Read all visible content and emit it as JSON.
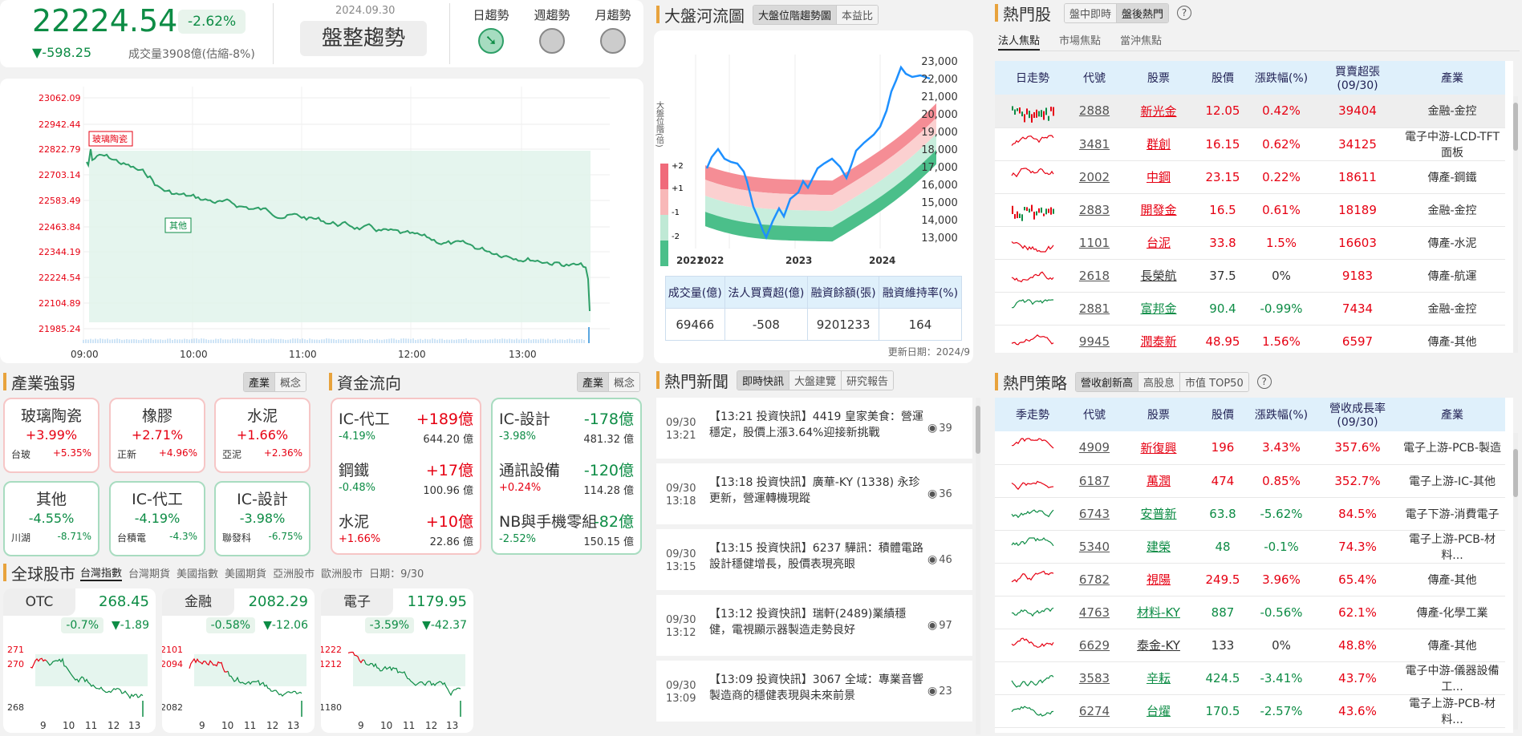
{
  "index": {
    "value": "22224.54",
    "pct": "-2.62%",
    "change": "▼-598.25",
    "volume": "成交量3908億(估縮-8%)",
    "date": "2024.09.30",
    "trend": "盤整趨勢",
    "trends": [
      "日趨勢",
      "週趨勢",
      "月趨勢"
    ]
  },
  "intraday": {
    "yticks": [
      "23062.09",
      "22942.44",
      "22822.79",
      "22703.14",
      "22583.49",
      "22463.84",
      "22344.19",
      "22224.54",
      "22104.89",
      "21985.24"
    ],
    "xticks": [
      "09:00",
      "10:00",
      "11:00",
      "12:00",
      "13:00"
    ],
    "tag1": "玻璃陶瓷",
    "tag2": "其他"
  },
  "river": {
    "title": "大盤河流圖",
    "tabs": [
      "大盤位階趨勢圖",
      "本益比"
    ],
    "ylabel": "大盤位階(倍)",
    "bands": [
      "+2",
      "+1",
      "-1",
      "-2"
    ],
    "yticks": [
      "23,000",
      "22,000",
      "21,000",
      "20,000",
      "19,000",
      "18,000",
      "17,000",
      "16,000",
      "15,000",
      "14,000",
      "13,000"
    ],
    "xticks": [
      "2021",
      "2022",
      "2023",
      "2024"
    ],
    "table_head": [
      "成交量(億)",
      "法人買賣超(億)",
      "融資餘額(張)",
      "融資維持率(%)"
    ],
    "table_vals": [
      "69466",
      "-508",
      "9201233",
      "164"
    ],
    "update": "更新日期：2024/9"
  },
  "hot": {
    "title": "熱門股",
    "tabs": [
      "盤中即時",
      "盤後熱門"
    ],
    "subtabs": [
      "法人焦點",
      "市場焦點",
      "當沖焦點"
    ],
    "head": [
      "日走勢",
      "代號",
      "股票",
      "股價",
      "漲跌幅(%)",
      "買賣超張(09/30)",
      "產業"
    ],
    "rows": [
      {
        "code": "2888",
        "name": "新光金",
        "price": "12.05",
        "pct": "0.42%",
        "amt": "39404",
        "ind": "金融-金控",
        "c": "up"
      },
      {
        "code": "3481",
        "name": "群創",
        "price": "16.15",
        "pct": "0.62%",
        "amt": "34125",
        "ind": "電子中游-LCD-TFT面板",
        "c": "up"
      },
      {
        "code": "2002",
        "name": "中鋼",
        "price": "23.15",
        "pct": "0.22%",
        "amt": "18611",
        "ind": "傳產-鋼鐵",
        "c": "up"
      },
      {
        "code": "2883",
        "name": "開發金",
        "price": "16.5",
        "pct": "0.61%",
        "amt": "18189",
        "ind": "金融-金控",
        "c": "up"
      },
      {
        "code": "1101",
        "name": "台泥",
        "price": "33.8",
        "pct": "1.5%",
        "amt": "16603",
        "ind": "傳產-水泥",
        "c": "up"
      },
      {
        "code": "2618",
        "name": "長榮航",
        "price": "37.5",
        "pct": "0%",
        "amt": "9183",
        "ind": "傳產-航運",
        "c": "nt"
      },
      {
        "code": "2881",
        "name": "富邦金",
        "price": "90.4",
        "pct": "-0.99%",
        "amt": "7434",
        "ind": "金融-金控",
        "c": "dn"
      },
      {
        "code": "9945",
        "name": "潤泰新",
        "price": "48.95",
        "pct": "1.56%",
        "amt": "6597",
        "ind": "傳產-其他",
        "c": "up"
      }
    ]
  },
  "strat": {
    "title": "熱門策略",
    "tabs": [
      "營收創新高",
      "高股息",
      "市值 TOP50"
    ],
    "head": [
      "季走勢",
      "代號",
      "股票",
      "股價",
      "漲跌幅(%)",
      "營收成長率(09/30)",
      "產業"
    ],
    "rows": [
      {
        "code": "4909",
        "name": "新復興",
        "price": "196",
        "pct": "3.43%",
        "g": "357.6%",
        "ind": "電子上游-PCB-製造",
        "c": "up"
      },
      {
        "code": "6187",
        "name": "萬潤",
        "price": "474",
        "pct": "0.85%",
        "g": "352.7%",
        "ind": "電子上游-IC-其他",
        "c": "up"
      },
      {
        "code": "6743",
        "name": "安普新",
        "price": "63.8",
        "pct": "-5.62%",
        "g": "84.5%",
        "ind": "電子下游-消費電子",
        "c": "dn"
      },
      {
        "code": "5340",
        "name": "建榮",
        "price": "48",
        "pct": "-0.1%",
        "g": "74.3%",
        "ind": "電子上游-PCB-材料...",
        "c": "dn"
      },
      {
        "code": "6782",
        "name": "視陽",
        "price": "249.5",
        "pct": "3.96%",
        "g": "65.4%",
        "ind": "傳產-其他",
        "c": "up"
      },
      {
        "code": "4763",
        "name": "材料-KY",
        "price": "887",
        "pct": "-0.56%",
        "g": "62.1%",
        "ind": "傳產-化學工業",
        "c": "dn"
      },
      {
        "code": "6629",
        "name": "泰金-KY",
        "price": "133",
        "pct": "0%",
        "g": "48.8%",
        "ind": "傳產-其他",
        "c": "nt"
      },
      {
        "code": "3583",
        "name": "辛耘",
        "price": "424.5",
        "pct": "-3.41%",
        "g": "43.7%",
        "ind": "電子中游-儀器設備工...",
        "c": "dn"
      },
      {
        "code": "6274",
        "name": "台燿",
        "price": "170.5",
        "pct": "-2.57%",
        "g": "43.6%",
        "ind": "電子上游-PCB-材料...",
        "c": "dn"
      }
    ]
  },
  "industry": {
    "title": "產業強弱",
    "tabs": [
      "產業",
      "概念"
    ],
    "items": [
      {
        "n": "玻璃陶瓷",
        "p": "+3.99%",
        "s": "台玻",
        "sp": "+5.35%",
        "c": "up"
      },
      {
        "n": "橡膠",
        "p": "+2.71%",
        "s": "正新",
        "sp": "+4.96%",
        "c": "up"
      },
      {
        "n": "水泥",
        "p": "+1.66%",
        "s": "亞泥",
        "sp": "+2.36%",
        "c": "up"
      },
      {
        "n": "其他",
        "p": "-4.55%",
        "s": "川湖",
        "sp": "-8.71%",
        "c": "dn"
      },
      {
        "n": "IC-代工",
        "p": "-4.19%",
        "s": "台積電",
        "sp": "-4.3%",
        "c": "dn"
      },
      {
        "n": "IC-設計",
        "p": "-3.98%",
        "s": "聯發科",
        "sp": "-6.75%",
        "c": "dn"
      }
    ]
  },
  "capital": {
    "title": "資金流向",
    "tabs": [
      "產業",
      "概念"
    ],
    "in": [
      {
        "n": "IC-代工",
        "v": "+189億",
        "p": "-4.19%",
        "t": "644.20 億",
        "pc": "dn"
      },
      {
        "n": "鋼鐵",
        "v": "+17億",
        "p": "-0.48%",
        "t": "100.96 億",
        "pc": "dn"
      },
      {
        "n": "水泥",
        "v": "+10億",
        "p": "+1.66%",
        "t": "22.86 億",
        "pc": "up"
      }
    ],
    "out": [
      {
        "n": "IC-設計",
        "v": "-178億",
        "p": "-3.98%",
        "t": "481.32 億",
        "pc": "dn"
      },
      {
        "n": "通訊設備",
        "v": "-120億",
        "p": "+0.24%",
        "t": "114.28 億",
        "pc": "up"
      },
      {
        "n": "NB與手機零組",
        "v": "-82億",
        "p": "-2.52%",
        "t": "150.15 億",
        "pc": "dn"
      }
    ]
  },
  "news": {
    "title": "熱門新聞",
    "tabs": [
      "即時快訊",
      "大盤建覽",
      "研究報告"
    ],
    "items": [
      {
        "d": "09/30",
        "t": "13:21",
        "x": "【13:21 投資快訊】4419 皇家美食：營運穩定，股價上漲3.64%迎接新挑戰",
        "v": "39"
      },
      {
        "d": "09/30",
        "t": "13:18",
        "x": "【13:18 投資快訊】廣華-KY (1338) 永珍更新，營運轉機現蹤",
        "v": "36"
      },
      {
        "d": "09/30",
        "t": "13:15",
        "x": "【13:15 投資快訊】6237 驊訊：積體電路設計穩健增長，股價表現亮眼",
        "v": "46"
      },
      {
        "d": "09/30",
        "t": "13:12",
        "x": "【13:12 投資快訊】瑞軒(2489)業績穩健，電視顯示器製造走勢良好",
        "v": "97"
      },
      {
        "d": "09/30",
        "t": "13:09",
        "x": "【13:09 投資快訊】3067 全域：專業音響製造商的穩健表現與未來前景",
        "v": "23"
      }
    ]
  },
  "global": {
    "title": "全球股市",
    "tabs": [
      "台灣指數",
      "台灣期貨",
      "美國指數",
      "美國期貨",
      "亞洲股市",
      "歐洲股市"
    ],
    "date": "日期：9/30",
    "cards": [
      {
        "n": "OTC",
        "v": "268.45",
        "p": "-0.7%",
        "c": "▼-1.89",
        "yt": [
          "271",
          "270",
          "268"
        ]
      },
      {
        "n": "金融",
        "v": "2082.29",
        "p": "-0.58%",
        "c": "▼-12.06",
        "yt": [
          "2101",
          "2094",
          "2082"
        ]
      },
      {
        "n": "電子",
        "v": "1179.95",
        "p": "-3.59%",
        "c": "▼-42.37",
        "yt": [
          "1222",
          "1212",
          "1180"
        ]
      }
    ],
    "xt": [
      "9",
      "10",
      "11",
      "12",
      "13"
    ]
  }
}
